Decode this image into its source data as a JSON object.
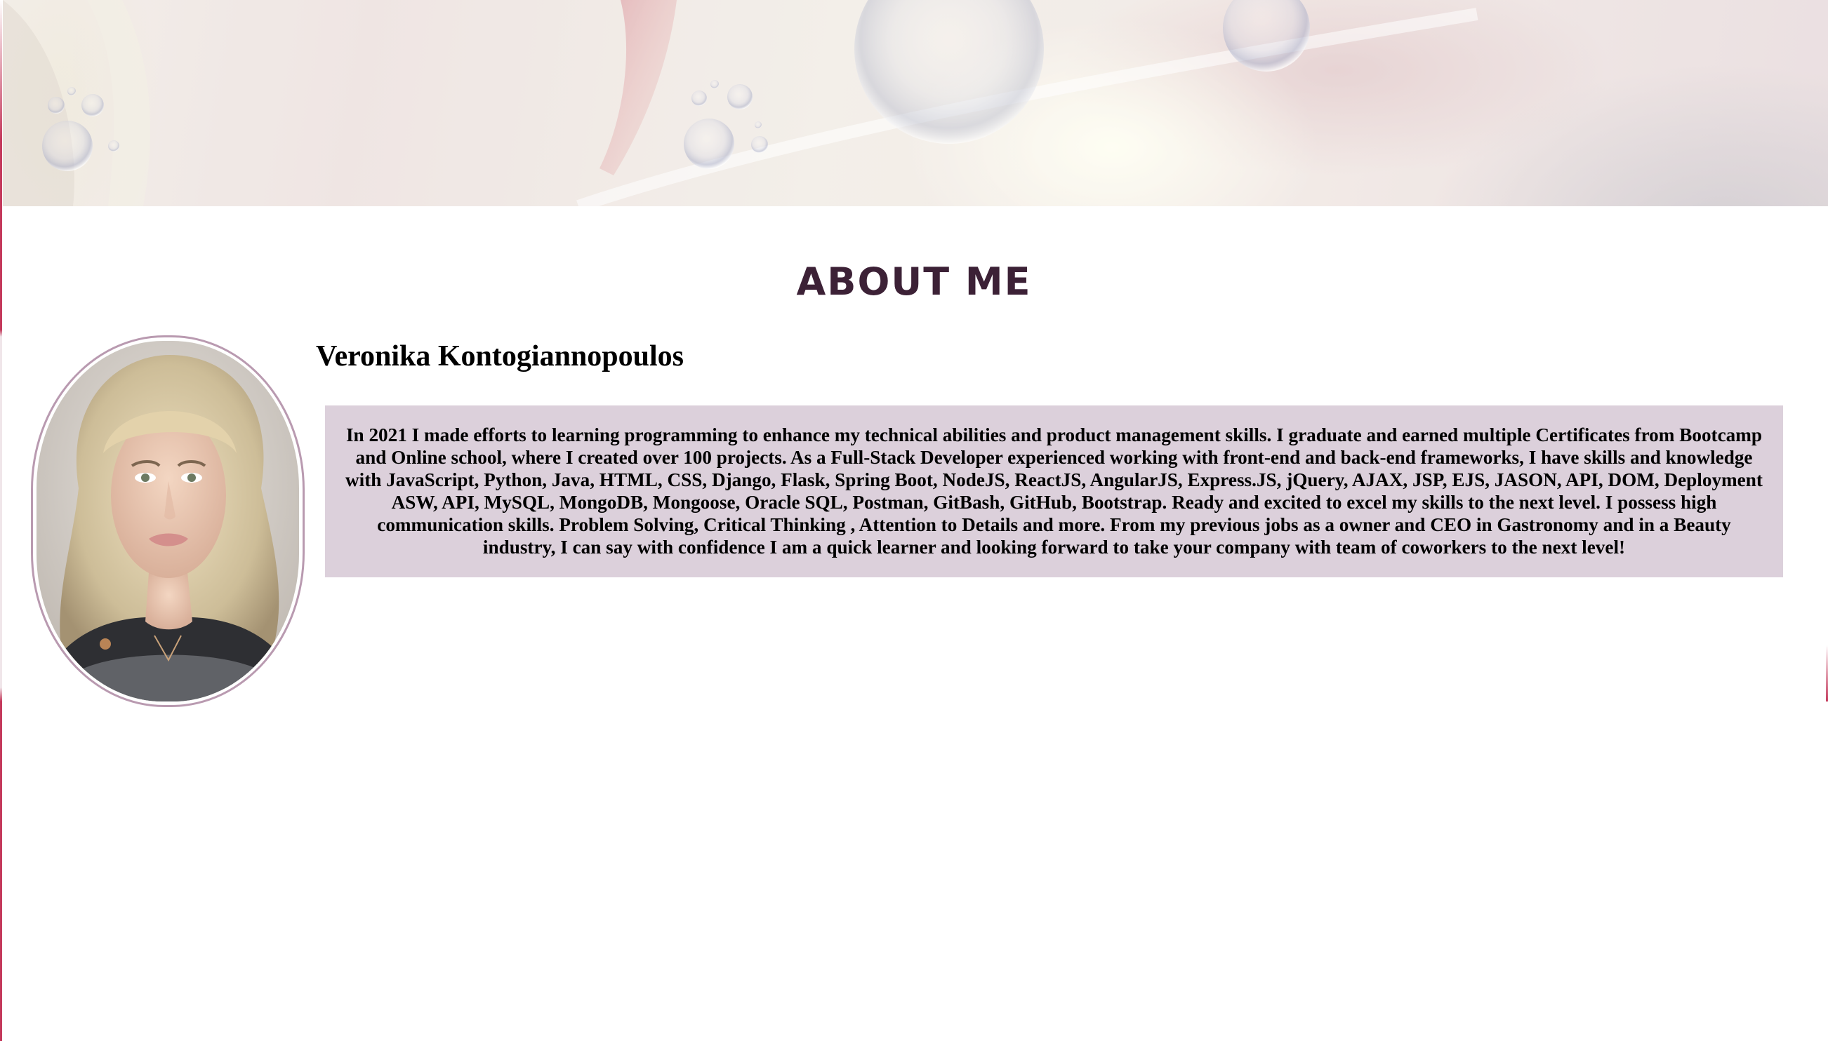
{
  "header": {
    "banner_image": "soap-bubbles-banner"
  },
  "about": {
    "title": "ABOUT ME",
    "name": "Veronika Kontogiannopoulos",
    "avatar": "profile-photo",
    "bio": "In 2021 I made efforts to learning programming to enhance my technical abilities and product management skills. I graduate and earned multiple Certificates from Bootcamp and Online school, where I created over 100 projects. As a Full-Stack Developer experienced working with front-end and back-end frameworks, I have skills and knowledge with JavaScript, Python, Java, HTML, CSS, Django, Flask, Spring Boot, NodeJS, ReactJS, AngularJS, Express.JS, jQuery, AJAX, JSP, EJS, JASON, API, DOM, Deployment ASW, API, MySQL, MongoDB, Mongoose, Oracle SQL, Postman, GitBash, GitHub, Bootstrap. Ready and excited to excel my skills to the next level. I possess high communication skills. Problem Solving, Critical Thinking , Attention to Details and more. From my previous jobs as a owner and CEO in Gastronomy and in a Beauty industry, I can say with confidence I am a quick learner and looking forward to take your company with team of coworkers to the next level!"
  },
  "colors": {
    "title": "#3c2136",
    "bio_background": "#dcd0db",
    "avatar_border": "#b99ab0",
    "edge_accent": "#c43a5c"
  }
}
